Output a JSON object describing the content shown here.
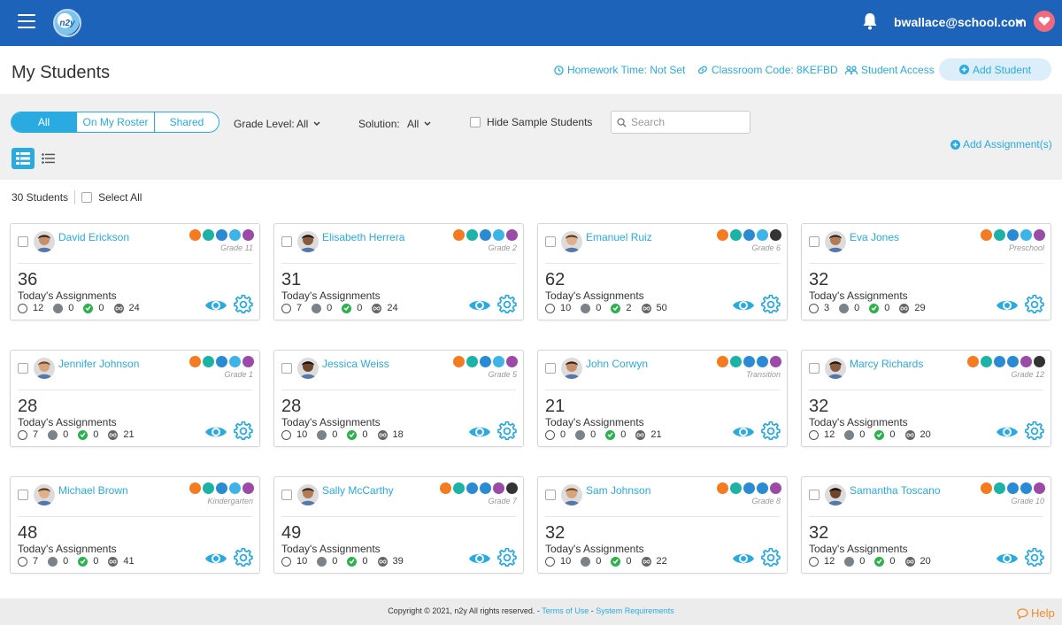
{
  "header": {
    "user_email": "bwallace@school.com",
    "title": "My Students",
    "homework_time": "Homework Time: Not Set",
    "classroom_code": "Classroom Code: 8KEFBD",
    "student_access": "Student Access",
    "add_student": "Add Student"
  },
  "filters": {
    "segments": [
      "All",
      "On My Roster",
      "Shared"
    ],
    "grade_level_label": "Grade Level:",
    "grade_level_value": "All",
    "solution_label": "Solution:",
    "solution_value": "All",
    "hide_sample": "Hide Sample Students",
    "search_placeholder": "Search",
    "add_assignments": "Add Assignment(s)"
  },
  "summary": {
    "count": "30 Students",
    "select_all": "Select All"
  },
  "assignments_label": "Today's Assignments",
  "students": [
    {
      "name": "David Erickson",
      "grade": "Grade 11",
      "total": "36",
      "open": "12",
      "progress": "0",
      "done": "0",
      "unlimited": "24",
      "badges": [
        "orange",
        "teal",
        "blue",
        "sky",
        "purple"
      ]
    },
    {
      "name": "Elisabeth Herrera",
      "grade": "Grade 2",
      "total": "31",
      "open": "7",
      "progress": "0",
      "done": "0",
      "unlimited": "24",
      "badges": [
        "orange",
        "teal",
        "blue",
        "sky",
        "purple"
      ]
    },
    {
      "name": "Emanuel Ruiz",
      "grade": "Grade 6",
      "total": "62",
      "open": "10",
      "progress": "0",
      "done": "2",
      "unlimited": "50",
      "badges": [
        "orange",
        "teal",
        "blue",
        "sky",
        "black"
      ]
    },
    {
      "name": "Eva Jones",
      "grade": "Preschool",
      "total": "32",
      "open": "3",
      "progress": "0",
      "done": "0",
      "unlimited": "29",
      "badges": [
        "orange",
        "teal",
        "blue",
        "sky",
        "purple"
      ]
    },
    {
      "name": "Jennifer Johnson",
      "grade": "Grade 1",
      "total": "28",
      "open": "7",
      "progress": "0",
      "done": "0",
      "unlimited": "21",
      "badges": [
        "orange",
        "teal",
        "blue",
        "sky",
        "purple"
      ]
    },
    {
      "name": "Jessica Weiss",
      "grade": "Grade 5",
      "total": "28",
      "open": "10",
      "progress": "0",
      "done": "0",
      "unlimited": "18",
      "badges": [
        "orange",
        "teal",
        "blue",
        "sky",
        "purple"
      ]
    },
    {
      "name": "John Corwyn",
      "grade": "Transition",
      "total": "21",
      "open": "0",
      "progress": "0",
      "done": "0",
      "unlimited": "21",
      "badges": [
        "orange",
        "teal",
        "blue",
        "blue",
        "purple"
      ]
    },
    {
      "name": "Marcy Richards",
      "grade": "Grade 12",
      "total": "32",
      "open": "12",
      "progress": "0",
      "done": "0",
      "unlimited": "20",
      "badges": [
        "orange",
        "teal",
        "blue",
        "blue",
        "purple",
        "black"
      ]
    },
    {
      "name": "Michael Brown",
      "grade": "Kindergarten",
      "total": "48",
      "open": "7",
      "progress": "0",
      "done": "0",
      "unlimited": "41",
      "badges": [
        "orange",
        "teal",
        "blue",
        "sky",
        "purple"
      ]
    },
    {
      "name": "Sally McCarthy",
      "grade": "Grade 7",
      "total": "49",
      "open": "10",
      "progress": "0",
      "done": "0",
      "unlimited": "39",
      "badges": [
        "orange",
        "teal",
        "blue",
        "blue",
        "purple",
        "black"
      ]
    },
    {
      "name": "Sam Johnson",
      "grade": "Grade 8",
      "total": "32",
      "open": "10",
      "progress": "0",
      "done": "0",
      "unlimited": "22",
      "badges": [
        "orange",
        "teal",
        "blue",
        "blue",
        "purple"
      ]
    },
    {
      "name": "Samantha Toscano",
      "grade": "Grade 10",
      "total": "32",
      "open": "12",
      "progress": "0",
      "done": "0",
      "unlimited": "20",
      "badges": [
        "orange",
        "teal",
        "blue",
        "blue",
        "purple"
      ]
    }
  ],
  "footer": {
    "copyright": "Copyright © 2021, n2y All rights reserved. - ",
    "terms": "Terms of Use",
    "dash": " - ",
    "sysreq": "System Requirements",
    "help": "Help"
  },
  "colors": {
    "brand": "#1d63b9",
    "accent": "#29abe2",
    "orange": "#f47b20",
    "teal": "#1bb3a6",
    "blue": "#2a8ad4",
    "sky": "#3cb4e7",
    "purple": "#9b4aa8",
    "black": "#333333"
  }
}
